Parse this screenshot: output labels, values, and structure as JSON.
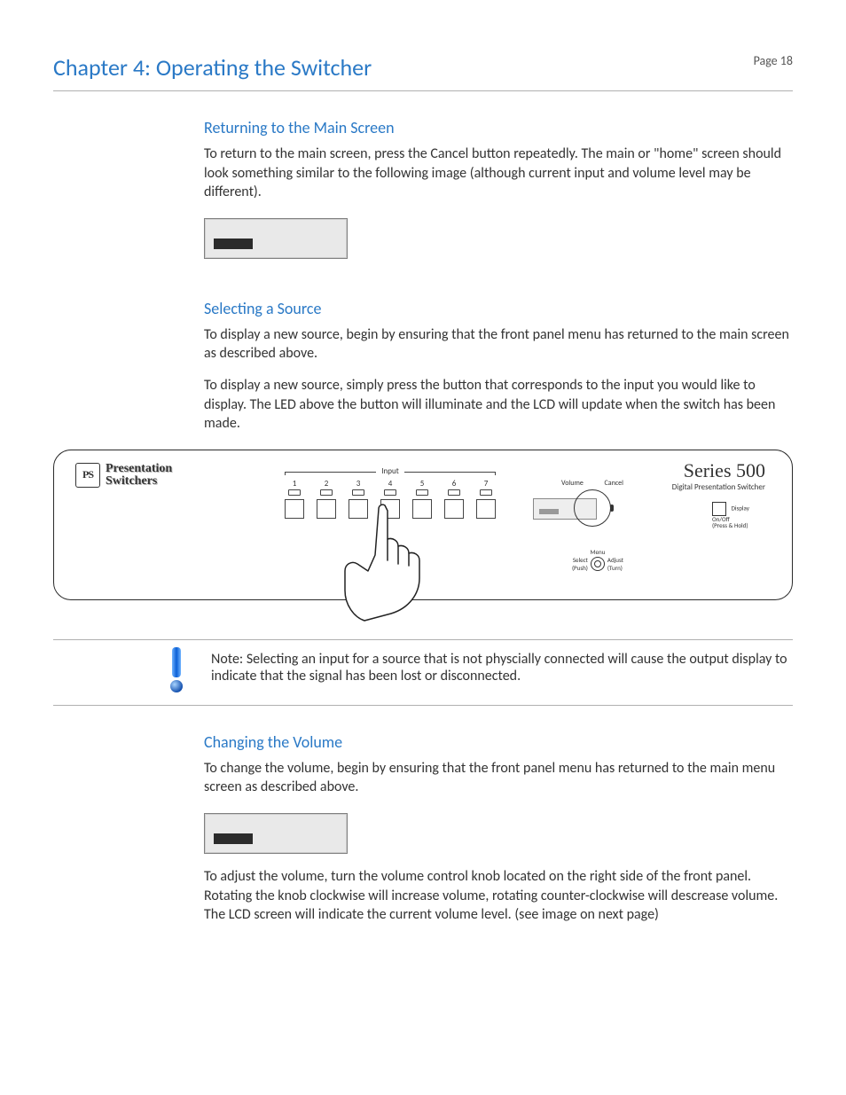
{
  "header": {
    "chapter": "Chapter 4: Operating the Switcher",
    "page_label": "Page 18"
  },
  "section_main": {
    "title": "Returning to the Main Screen",
    "p1": "To return to the main screen, press the Cancel button repeatedly. The main or \"home\" screen should look something similar to the following image (although current input and volume level may be different)."
  },
  "section_select": {
    "title": "Selecting a Source",
    "p1": "To display a new source, begin by ensuring that the front panel menu has returned to the main screen as described above.",
    "p2": "To display a new source, simply press the button that corresponds to the input you would like to display. The LED above the button will illuminate and the LCD will update when the switch has been made."
  },
  "panel": {
    "brand_line1": "Presentation",
    "brand_line2": "Switchers",
    "brand_logo": "PS",
    "series": "Series 500",
    "series_sub": "Digital Presentation Switcher",
    "input_label": "Input",
    "inputs": [
      "1",
      "2",
      "3",
      "4",
      "5",
      "6",
      "7"
    ],
    "volume": "Volume",
    "cancel": "Cancel",
    "menu": "Menu",
    "select": "Select",
    "select_sub": "(Push)",
    "adjust": "Adjust",
    "adjust_sub": "(Turn)",
    "display_onoff": "Display On/Off",
    "display_hint": "(Press & Hold)"
  },
  "note": {
    "text": "Note: Selecting an input for a source that is not physcially connected will cause the output display to indicate that the signal has been lost or disconnected."
  },
  "section_volume": {
    "title": "Changing the Volume",
    "p1": "To change the volume, begin by ensuring that the front panel menu has returned to the main menu screen as described above.",
    "p2": "To adjust the volume, turn the volume control knob located on the right side of the front panel. Rotating the knob clockwise will increase volume, rotating counter-clockwise will descrease volume. The LCD screen will indicate the current volume level.  (see image on next page)"
  }
}
